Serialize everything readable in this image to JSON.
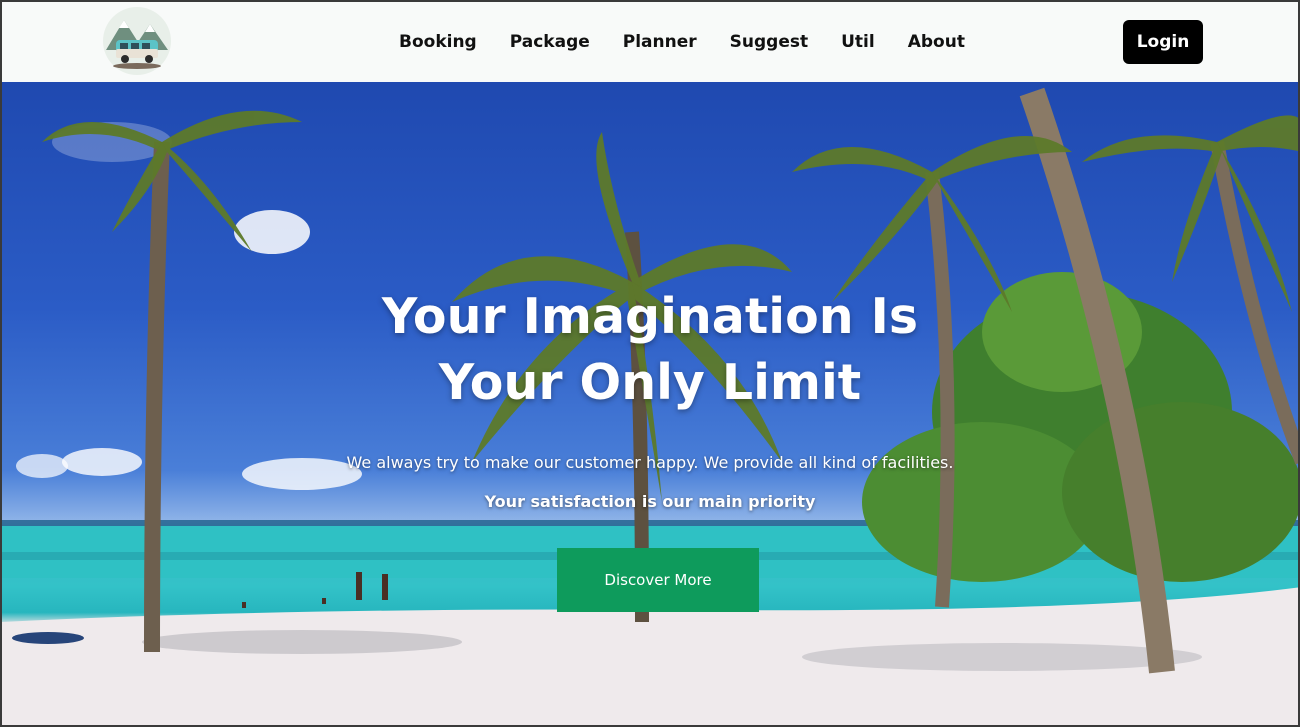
{
  "nav": {
    "links": [
      "Booking",
      "Package",
      "Planner",
      "Suggest",
      "Util",
      "About"
    ],
    "login_label": "Login"
  },
  "hero": {
    "headline_line1": "Your Imagination Is",
    "headline_line2": "Your Only Limit",
    "tagline": "We always try to make our customer happy. We provide all kind of facilities.",
    "priority": "Your satisfaction is our main priority",
    "cta_label": "Discover More"
  },
  "colors": {
    "navbar_bg": "#f8faf9",
    "login_bg": "#000000",
    "cta_bg": "#0e9b5c",
    "sky": "#2b5cc6",
    "sea": "#33c2c8",
    "sand": "#f3eff1"
  },
  "icons": {
    "logo": "camper-van-mountains-logo"
  }
}
